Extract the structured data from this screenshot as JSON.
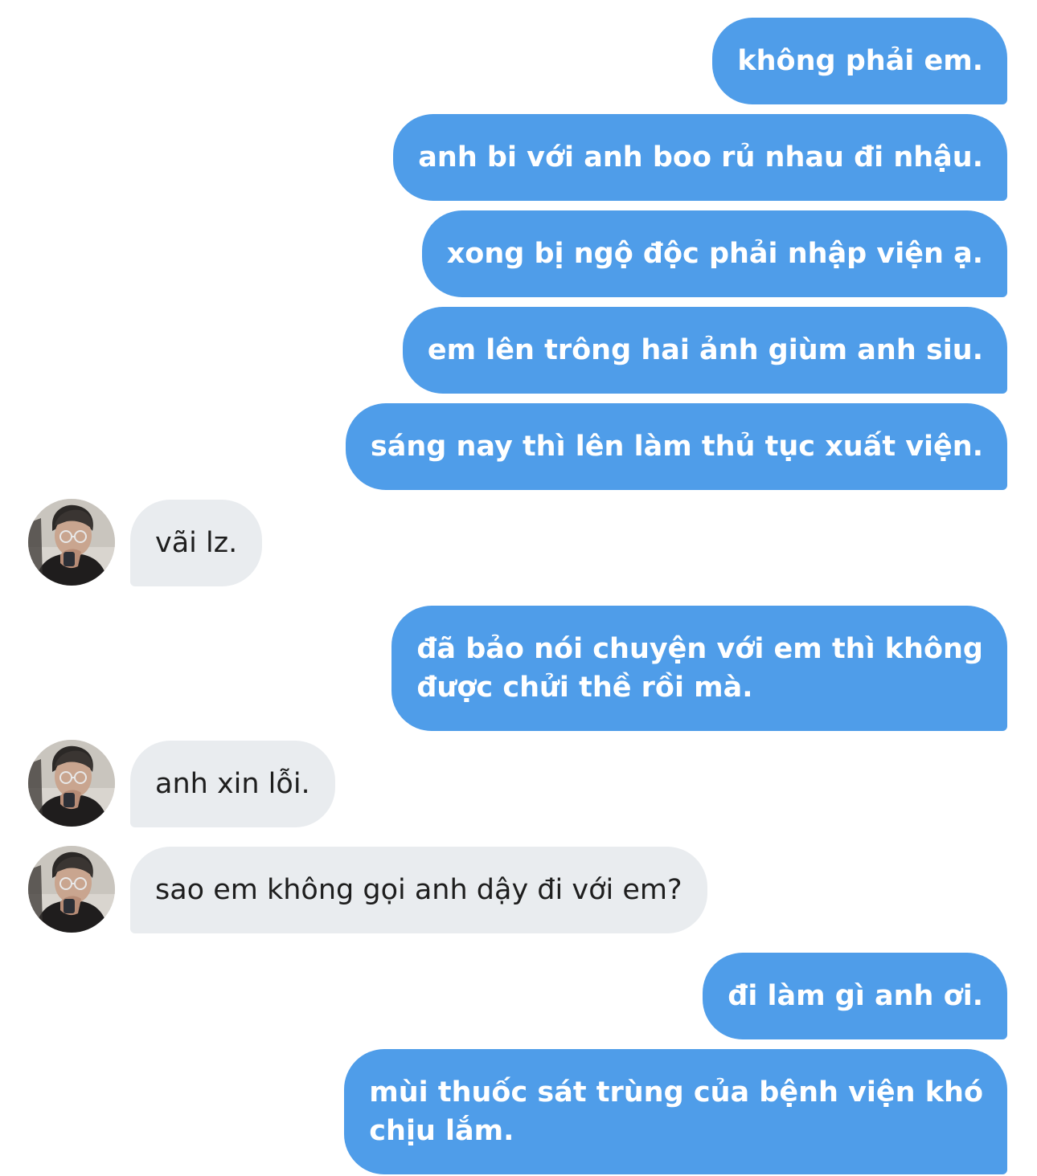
{
  "colors": {
    "outgoing_bubble": "#4f9de9",
    "incoming_bubble": "#e9ecef",
    "outgoing_text": "#ffffff",
    "incoming_text": "#1e1e1e"
  },
  "avatar": {
    "icon": "avatar-photo"
  },
  "messages": [
    {
      "direction": "out",
      "text": "không phải em."
    },
    {
      "direction": "out",
      "text": "anh bi với anh boo rủ nhau đi nhậu."
    },
    {
      "direction": "out",
      "text": "xong bị ngộ độc phải nhập viện ạ."
    },
    {
      "direction": "out",
      "text": "em lên trông hai ảnh giùm anh siu."
    },
    {
      "direction": "out",
      "text": "sáng nay thì lên làm thủ tục xuất viện."
    },
    {
      "direction": "in",
      "text": "vãi lz."
    },
    {
      "direction": "out",
      "text": "đã bảo nói chuyện với em thì không\nđược chửi thề rồi mà."
    },
    {
      "direction": "in",
      "text": "anh xin lỗi."
    },
    {
      "direction": "in",
      "text": "sao em không gọi anh dậy đi với em?"
    },
    {
      "direction": "out",
      "text": "đi làm gì anh ơi."
    },
    {
      "direction": "out",
      "text": "mùi thuốc sát trùng của bệnh viện khó\nchịu lắm."
    }
  ]
}
